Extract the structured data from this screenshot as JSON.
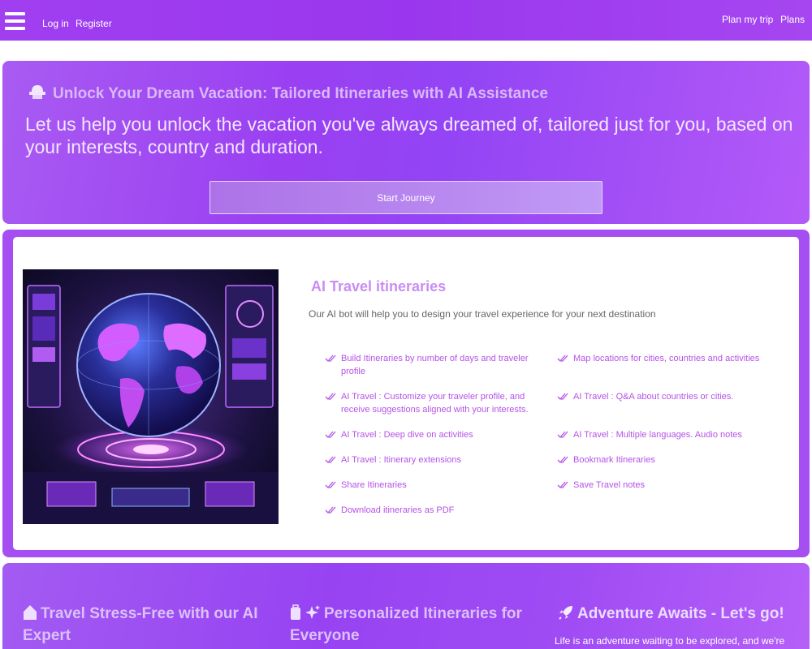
{
  "navbar": {
    "login": "Log in",
    "register": "Register",
    "plan_trip": "Plan my trip",
    "plans": "Plans"
  },
  "hero": {
    "title": "Unlock Your Dream Vacation: Tailored Itineraries with AI Assistance",
    "title_icon": "hat-icon",
    "subtitle": "Let us help you unlock the vacation you've always dreamed of, tailored just for you, based on your interests, country and duration.",
    "cta": "Start Journey"
  },
  "features": {
    "title": "AI Travel itineraries",
    "subtitle": "Our AI bot will help you to design your travel experience for your next destination",
    "items": [
      "Build Itineraries by number of days and traveler profile",
      "Map locations for cities, countries and activities",
      "AI Travel : Customize your traveler profile, and receive suggestions aligned with your interests.",
      "AI Travel : Q&A about countries or cities.",
      "AI Travel : Deep dive on activities",
      "AI Travel : Multiple languages. Audio notes",
      "AI Travel : Itinerary extensions",
      "Bookmark Itineraries",
      "Share Itineraries",
      "Save Travel notes",
      "Download itineraries as PDF"
    ]
  },
  "bottom": {
    "col1_title": "Travel Stress-Free with our AI Expert",
    "col2_title": "Personalized Itineraries for Everyone",
    "col3_title": "Adventure Awaits - Let's go!",
    "col3_text": "Life is an adventure waiting to be explored, and we're"
  },
  "colors": {
    "brand": "#9b3cef",
    "accent_text": "#b552e8",
    "heading": "#c98df3"
  }
}
